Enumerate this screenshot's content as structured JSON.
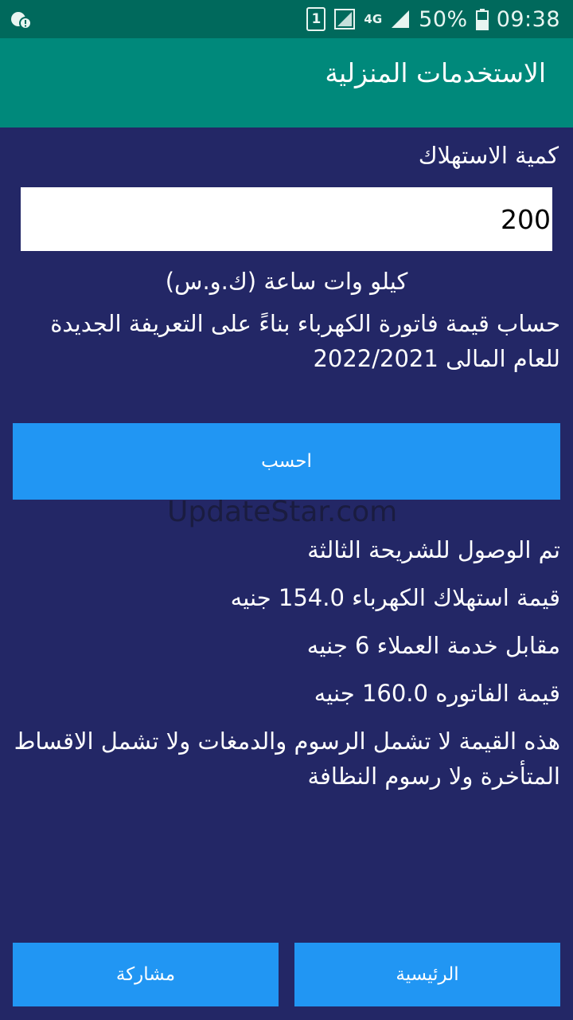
{
  "status_bar": {
    "sim": "1",
    "network": "4G",
    "battery_pct": "50%",
    "time": "09:38"
  },
  "app_bar": {
    "title": "الاستخدمات المنزلية"
  },
  "form": {
    "label": "كمية الاستهلاك",
    "value": "200",
    "unit": "كيلو وات ساعة (ك.و.س)",
    "description": "حساب قيمة فاتورة الكهرباء بناءً على التعريفة الجديدة للعام المالى 2022/2021",
    "calc_button": "احسب"
  },
  "watermark": "UpdateStar.com",
  "results": {
    "tier": "تم الوصول للشريحة الثالثة",
    "consumption_value": "قيمة استهلاك الكهرباء 154.0 جنيه",
    "service_fee": "مقابل خدمة العملاء 6 جنيه",
    "bill_total": "قيمة الفاتوره 160.0 جنيه",
    "note": "هذه القيمة لا تشمل الرسوم والدمغات ولا تشمل الاقساط المتأخرة ولا رسوم النظافة"
  },
  "bottom_bar": {
    "home": "الرئيسية",
    "share": "مشاركة"
  }
}
